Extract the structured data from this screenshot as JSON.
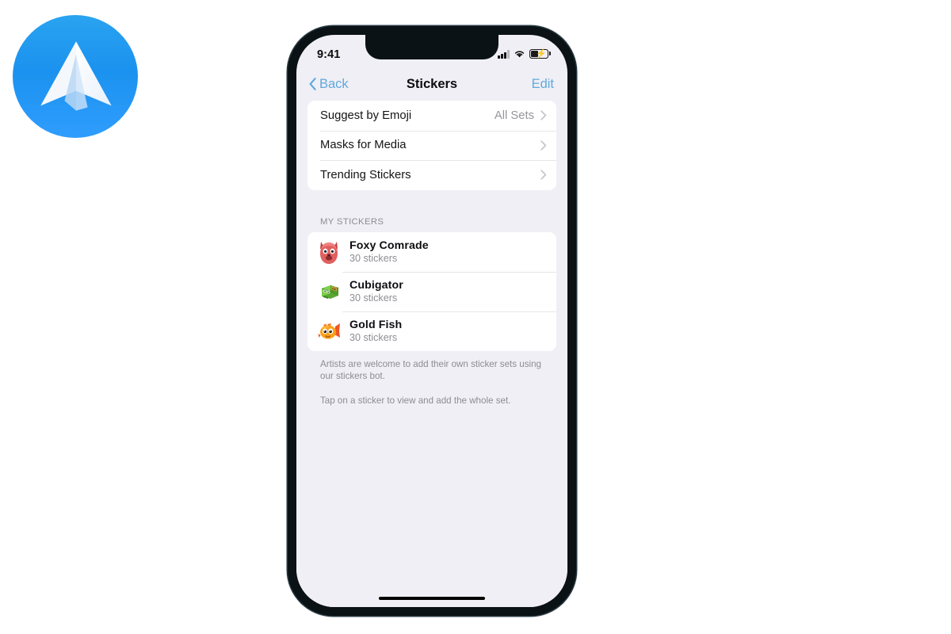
{
  "brand": {
    "logo_icon": "paper-plane-icon",
    "accent_color": "#2196f3"
  },
  "phone": {
    "status_bar": {
      "time": "9:41",
      "signal_icon": "cellular-signal-icon",
      "wifi_icon": "wifi-icon",
      "battery_icon": "battery-charging-icon"
    },
    "nav": {
      "back_label": "Back",
      "back_icon": "chevron-left-icon",
      "title": "Stickers",
      "edit_label": "Edit",
      "link_color": "#5ea9dd"
    },
    "settings_rows": [
      {
        "label": "Suggest by Emoji",
        "value": "All Sets",
        "chevron": "chevron-right-icon"
      },
      {
        "label": "Masks for Media",
        "value": "",
        "chevron": "chevron-right-icon"
      },
      {
        "label": "Trending Stickers",
        "value": "",
        "chevron": "chevron-right-icon"
      }
    ],
    "my_stickers": {
      "section_title": "MY STICKERS",
      "packs": [
        {
          "name": "Foxy Comrade",
          "count": "30 stickers",
          "thumb_icon": "fox-face-sticker-icon",
          "thumb_color": "#e0605e"
        },
        {
          "name": "Cubigator",
          "count": "30 stickers",
          "thumb_icon": "cube-alligator-sticker-icon",
          "thumb_color": "#6ec24a"
        },
        {
          "name": "Gold Fish",
          "count": "30 stickers",
          "thumb_icon": "goldfish-sticker-icon",
          "thumb_color": "#f5a623"
        }
      ]
    },
    "footnotes": [
      "Artists are welcome to add their own sticker sets using our stickers bot.",
      "Tap on a sticker to view and add the whole set."
    ]
  }
}
